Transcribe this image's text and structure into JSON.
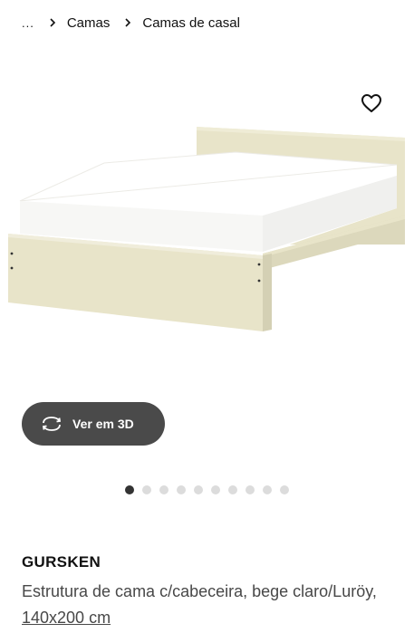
{
  "breadcrumb": {
    "ellipsis": "...",
    "items": [
      "Camas",
      "Camas de casal"
    ]
  },
  "icons": {
    "wishlist": "heart-icon",
    "view3d": "rotate-3d-icon",
    "separator": "chevron-right-icon"
  },
  "view3d_button": {
    "label": "Ver em 3D"
  },
  "carousel": {
    "count": 10,
    "active_index": 0
  },
  "product": {
    "name": "GURSKEN",
    "description": "Estrutura de cama c/cabeceira, bege claro/Luröy, ",
    "size": "140x200 cm"
  },
  "colors": {
    "frame": "#e8e4c9",
    "mattress": "#ffffff",
    "button_bg": "#4a4a4a",
    "dot_active": "#333333",
    "dot_inactive": "#dcdcdc"
  }
}
